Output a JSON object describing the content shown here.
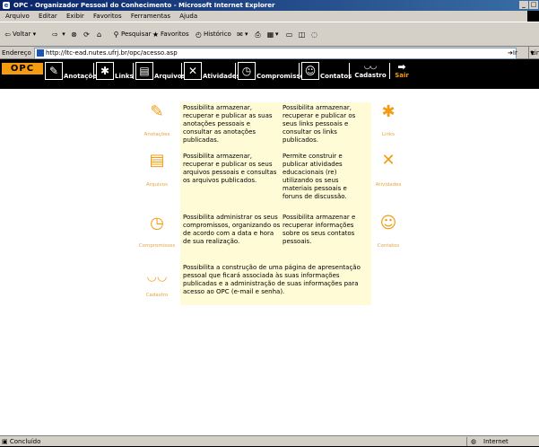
{
  "window": {
    "title": "OPC - Organizador Pessoal do Conhecimento - Microsoft Internet Explorer",
    "controls": [
      "_",
      "□"
    ]
  },
  "menu": [
    "Arquivo",
    "Editar",
    "Exibir",
    "Favoritos",
    "Ferramentas",
    "Ajuda"
  ],
  "toolbar": {
    "back": "Voltar",
    "search": "Pesquisar",
    "favorites": "Favoritos",
    "history": "Histórico"
  },
  "address": {
    "label": "Endereço",
    "url": "http://ltc-ead.nutes.ufrj.br/opc/acesso.asp",
    "go": "Ir",
    "links": "Lin"
  },
  "app": {
    "logo": "OPC",
    "nav": [
      {
        "label": "Anotações",
        "icon": "pencil-icon",
        "glyph": "✎"
      },
      {
        "label": "Links",
        "icon": "web-icon",
        "glyph": "✱"
      },
      {
        "label": "Arquivos",
        "icon": "file-cabinet-icon",
        "glyph": "▤"
      },
      {
        "label": "Atividades",
        "icon": "tools-icon",
        "glyph": "✕"
      },
      {
        "label": "Compromissos",
        "icon": "clock-icon",
        "glyph": "◷"
      },
      {
        "label": "Contatos",
        "icon": "smiley-icon",
        "glyph": "☺"
      },
      {
        "label": "Cadastro",
        "icon": "glasses-icon",
        "glyph": "◡◡"
      }
    ],
    "exit": {
      "label": "Sair",
      "glyph": "➡"
    }
  },
  "features": {
    "anotacoes": {
      "label": "Anotações",
      "glyph": "✎",
      "text": "Possibilita armazenar, recuperar e publicar as suas anotações pessoais e consultar as anotações publicadas."
    },
    "links": {
      "label": "Links",
      "glyph": "✱",
      "text": "Possibilita armazenar, recuperar e publicar os seus links pessoais e consultar os links publicados."
    },
    "arquivos": {
      "label": "Arquivos",
      "glyph": "▤",
      "text": "Possibilita armazenar, recuperar e publicar os seus arquivos pessoais e consultas os arquivos publicados."
    },
    "atividades": {
      "label": "Atividades",
      "glyph": "✕",
      "text": "Permite construir e publicar atividades educacionais (re) utilizando os seus materiais pessoais e foruns de discussão."
    },
    "compromissos": {
      "label": "Compromissos",
      "glyph": "◷",
      "text": "Possibilita administrar os seus compromissos, organizando os de acordo com a data e hora de sua realização."
    },
    "contatos": {
      "label": "Contatos",
      "glyph": "☺",
      "text": "Possibilita armazenar e recuperar informações sobre os seus contatos pessoais."
    },
    "cadastro": {
      "label": "Cadastro",
      "glyph": "◡◡",
      "text": "Possibilita a construção de uma página de apresentação pessoal que ficará associada às suas informações publicadas e a administração de suas informações para acesso ao OPC (e-mail e senha)."
    }
  },
  "status": {
    "text": "Concluído",
    "zone": "Internet"
  }
}
